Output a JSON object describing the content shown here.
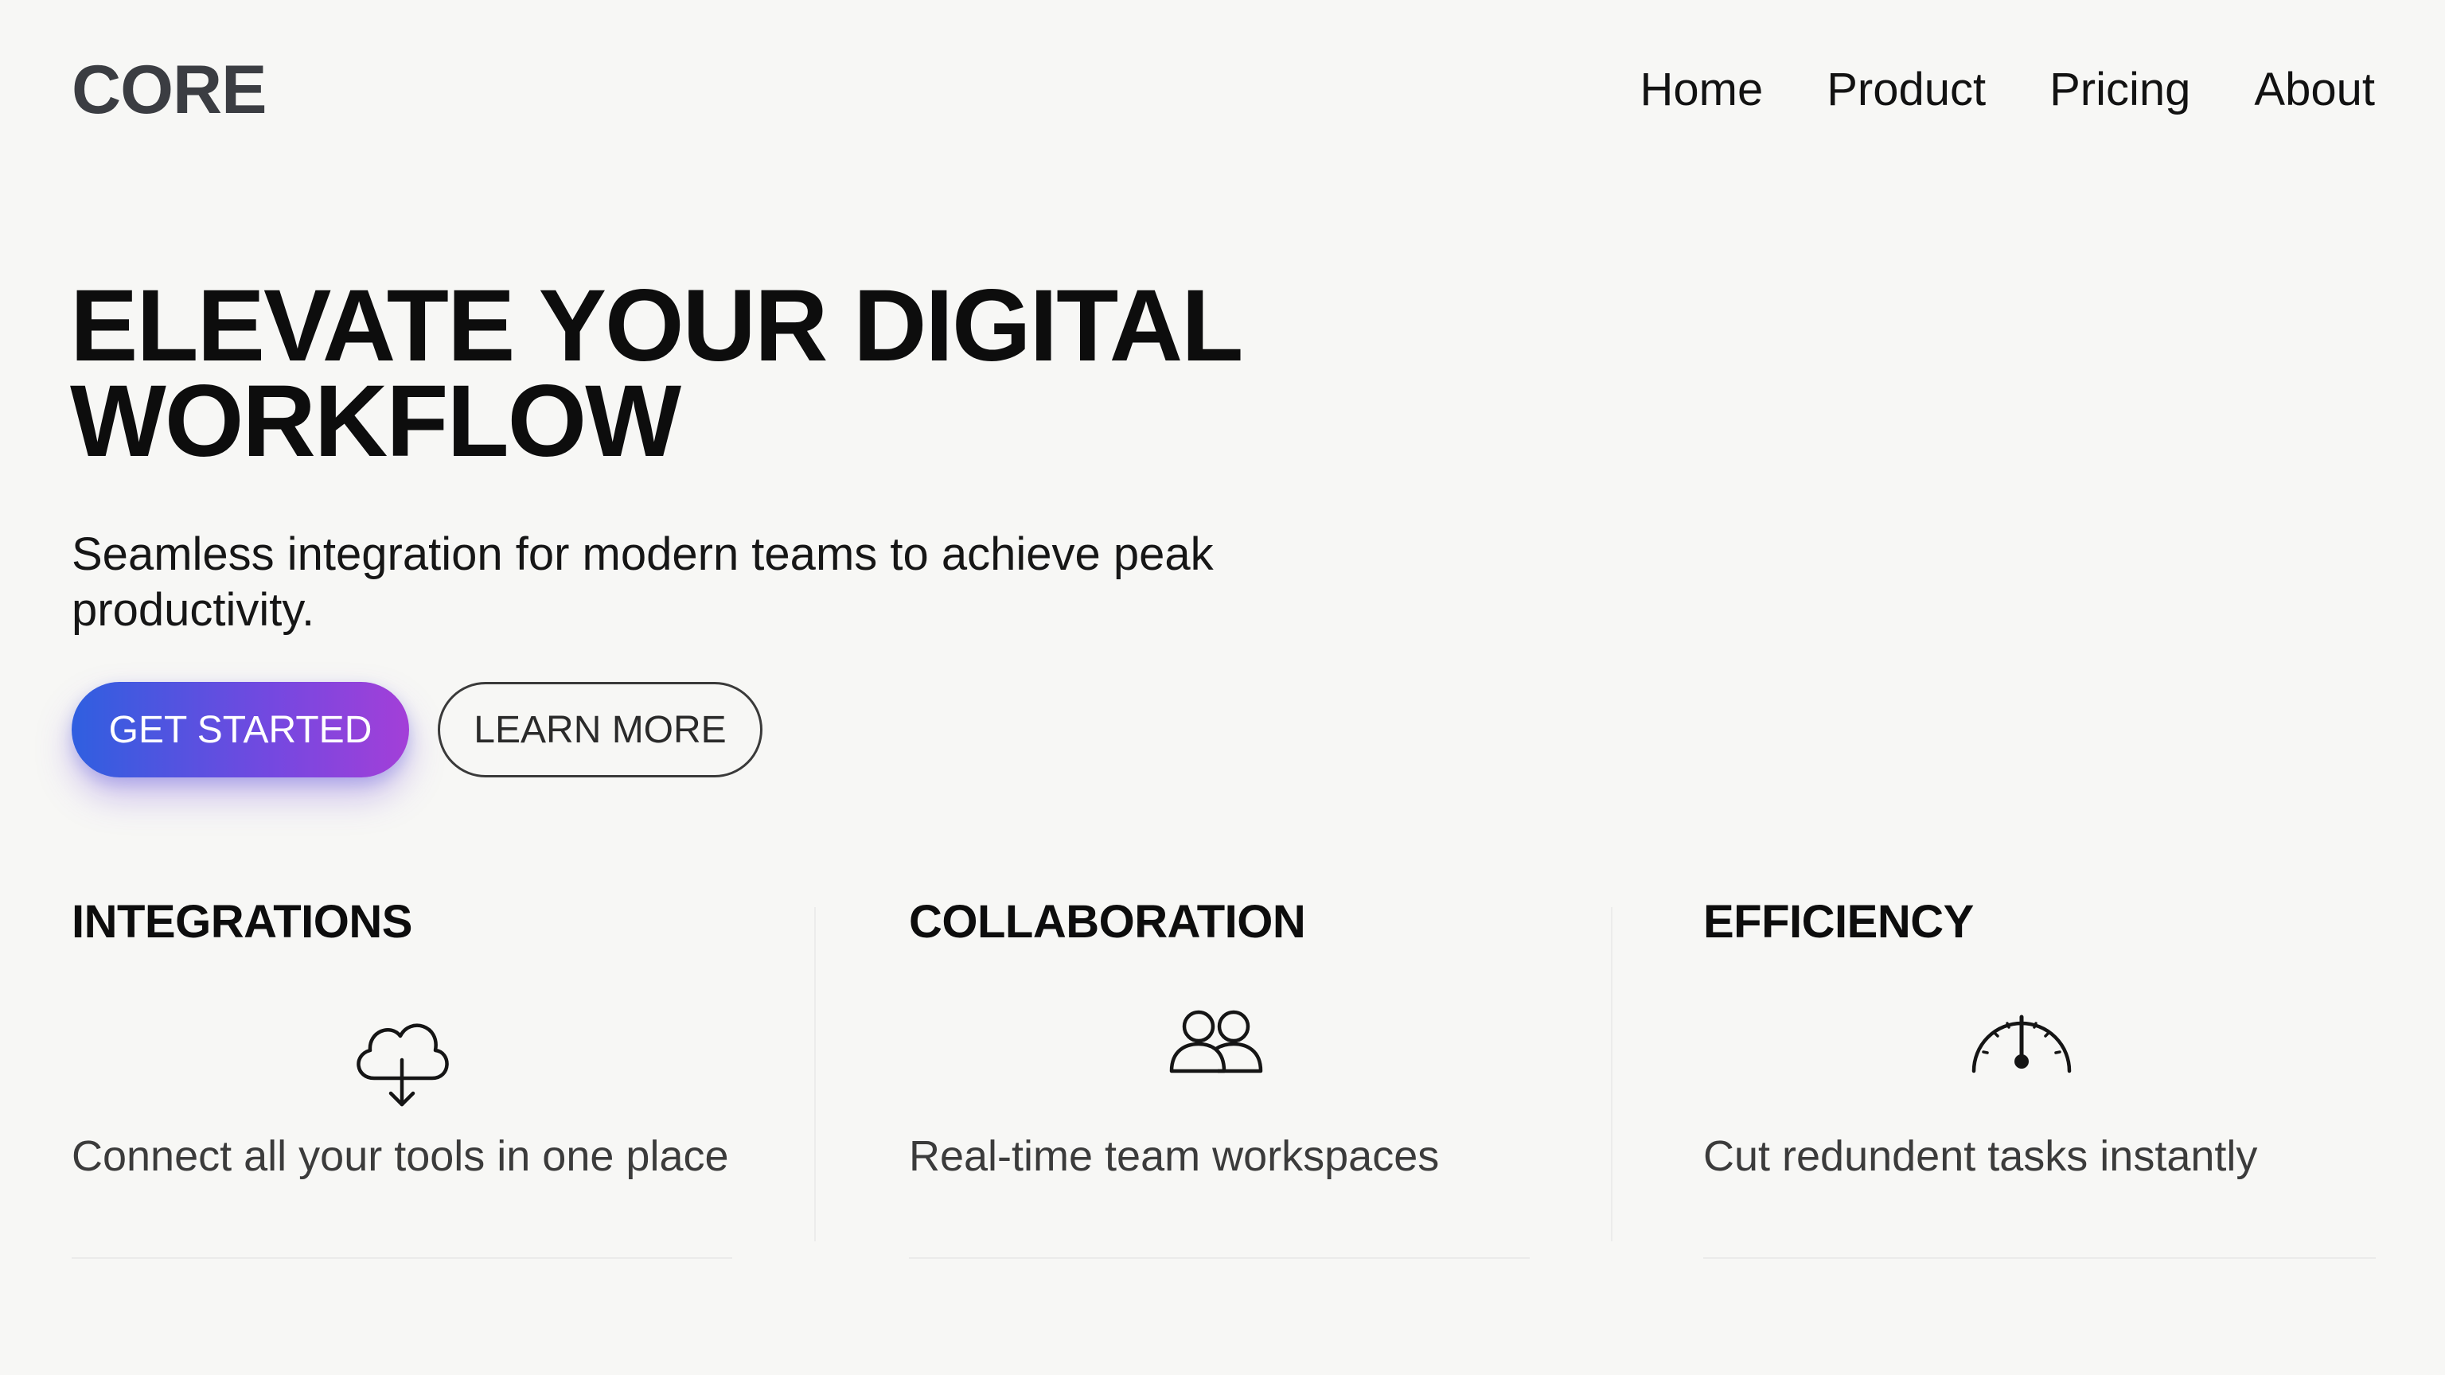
{
  "brand": {
    "logo": "CORE"
  },
  "nav": {
    "items": [
      {
        "label": "Home"
      },
      {
        "label": "Product"
      },
      {
        "label": "Pricing"
      },
      {
        "label": "About"
      }
    ]
  },
  "hero": {
    "title": "ELEVATE YOUR DIGITAL WORKFLOW",
    "subtitle": "Seamless integration for modern teams to achieve peak productivity.",
    "primary_button": "GET STARTED",
    "secondary_button": "LEARN MORE"
  },
  "features": [
    {
      "title": "INTEGRATIONS",
      "icon": "cloud-download-icon",
      "description": "Connect all your tools in one place"
    },
    {
      "title": "COLLABORATION",
      "icon": "team-users-icon",
      "description": "Real-time team workspaces"
    },
    {
      "title": "EFFICIENCY",
      "icon": "speedometer-icon",
      "description": "Cut redundent tasks instantly"
    }
  ],
  "colors": {
    "background": "#f7f7f5",
    "primary_gradient_start": "#2f5fe0",
    "primary_gradient_end": "#a33fd8",
    "text": "#0d0d0d"
  }
}
